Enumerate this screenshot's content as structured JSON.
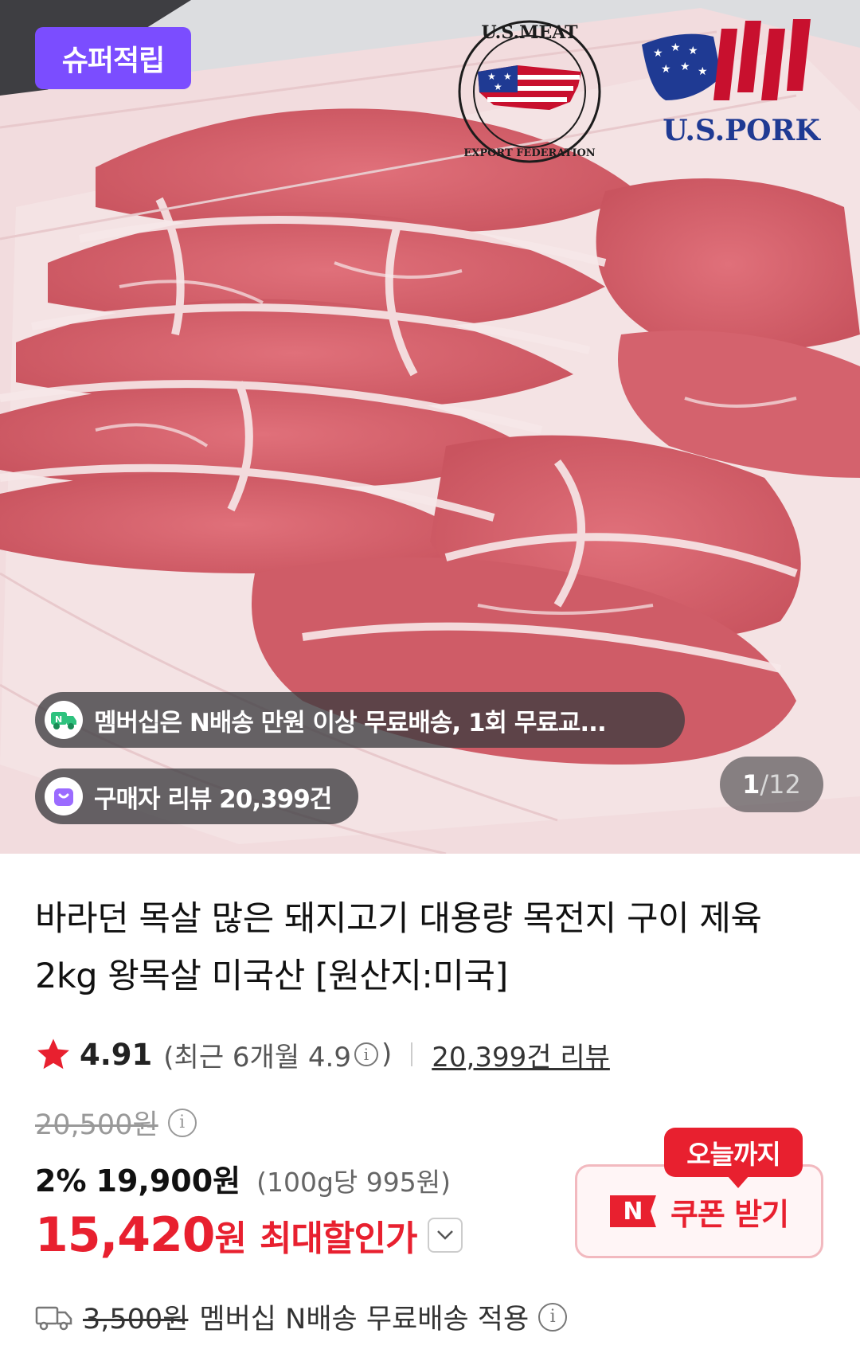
{
  "hero": {
    "badge": "슈퍼적립",
    "logos": {
      "usmef_top": "U.S.MEAT",
      "usmef_bottom": "EXPORT FEDERATION",
      "uspork": "U.S.PORK"
    },
    "membership_text": "멤버십은 N배송 만원 이상 무료배송, 1회 무료교...",
    "review_text": "구매자 리뷰 20,399건",
    "counter": {
      "current": "1",
      "separator": "/",
      "total": "12"
    }
  },
  "product": {
    "title": "바라던 목살 많은 돼지고기 대용량 목전지 구이 제육 2kg 왕목살 미국산 [원산지:미국]",
    "rating": "4.91",
    "recent_rating_text": "(최근 6개월 4.9",
    "recent_rating_close": ")",
    "review_link": "20,399건 리뷰",
    "original_price": "20,500원",
    "discount_rate": "2%",
    "sale_price": "19,900원",
    "unit_price": "(100g당 995원)",
    "best_price_amount": "15,420",
    "best_price_won": "원",
    "best_price_label": "최대할인가",
    "coupon_tag": "오늘까지",
    "coupon_mark": "N",
    "coupon_label": "쿠폰 받기",
    "shipping_fee": "3,500원",
    "shipping_text": "멤버십 N배송 무료배송 적용"
  },
  "colors": {
    "accent_red": "#e8202f",
    "badge_purple": "#7b4dff"
  }
}
